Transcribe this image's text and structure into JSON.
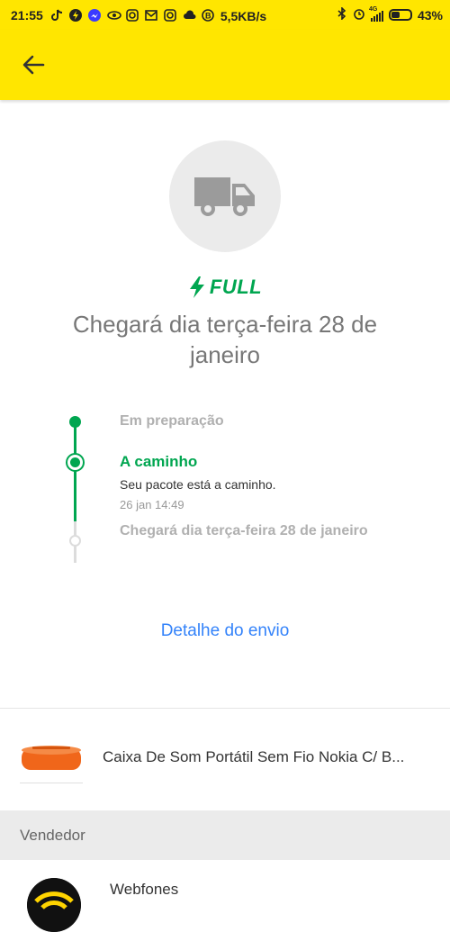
{
  "status_bar": {
    "time": "21:55",
    "network_speed": "5,5KB/s",
    "network_type": "4G",
    "battery": "43%"
  },
  "app_bar": {
    "back_icon": "arrow-left-icon",
    "color": "#ffe600"
  },
  "shipment": {
    "badge": "FULL",
    "badge_color": "#00a650",
    "headline": "Chegará dia terça-feira 28 de janeiro",
    "timeline": [
      {
        "label": "Em preparação",
        "state": "done"
      },
      {
        "label": "A caminho",
        "state": "current",
        "description": "Seu pacote está a caminho.",
        "date": "26 jan 14:49"
      },
      {
        "label": "Chegará dia terça-feira 28 de janeiro",
        "state": "pending"
      }
    ],
    "detail_link": "Detalhe do envio"
  },
  "product": {
    "name": "Caixa De Som Portátil Sem Fio Nokia C/ B..."
  },
  "seller": {
    "section_title": "Vendedor",
    "name": "Webfones"
  },
  "colors": {
    "accent_green": "#00a650",
    "link_blue": "#3483fa",
    "brand_yellow": "#ffe600"
  }
}
